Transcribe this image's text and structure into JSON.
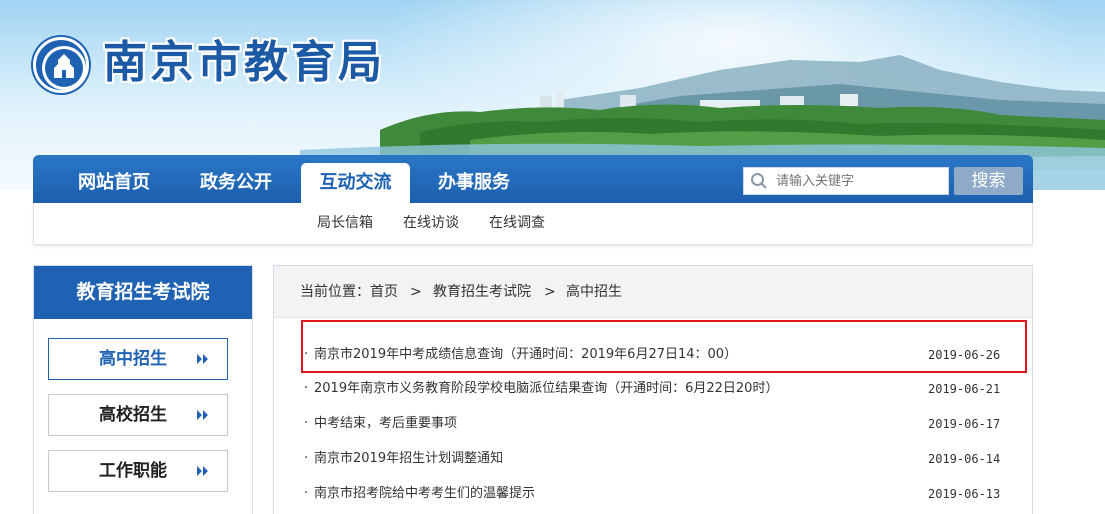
{
  "header": {
    "site_title": "南京市教育局"
  },
  "nav": {
    "items": [
      {
        "label": "网站首页"
      },
      {
        "label": "政务公开"
      },
      {
        "label": "互动交流",
        "active": true
      },
      {
        "label": "办事服务"
      }
    ],
    "search": {
      "placeholder": "请输入关键字",
      "button_label": "搜索",
      "icon": "search-icon"
    },
    "sub_items": [
      {
        "label": "局长信箱"
      },
      {
        "label": "在线访谈"
      },
      {
        "label": "在线调查"
      }
    ]
  },
  "sidebar": {
    "title": "教育招生考试院",
    "items": [
      {
        "label": "高中招生",
        "active": true
      },
      {
        "label": "高校招生"
      },
      {
        "label": "工作职能"
      }
    ]
  },
  "breadcrumb": {
    "prefix": "当前位置：",
    "items": [
      "首页",
      "教育招生考试院",
      "高中招生"
    ],
    "separator": ">"
  },
  "news": [
    {
      "title": "南京市2019年中考成绩信息查询（开通时间：2019年6月27日14：00）",
      "date": "2019-06-26",
      "highlighted": true
    },
    {
      "title": "2019年南京市义务教育阶段学校电脑派位结果查询（开通时间：6月22日20时）",
      "date": "2019-06-21"
    },
    {
      "title": "中考结束，考后重要事项",
      "date": "2019-06-17"
    },
    {
      "title": "南京市2019年招生计划调整通知",
      "date": "2019-06-14"
    },
    {
      "title": "南京市招考院给中考考生们的温馨提示",
      "date": "2019-06-13"
    }
  ],
  "colors": {
    "primary_blue": "#1f62b3",
    "highlight_red": "#e0141c",
    "search_button": "#8fa9c8"
  }
}
